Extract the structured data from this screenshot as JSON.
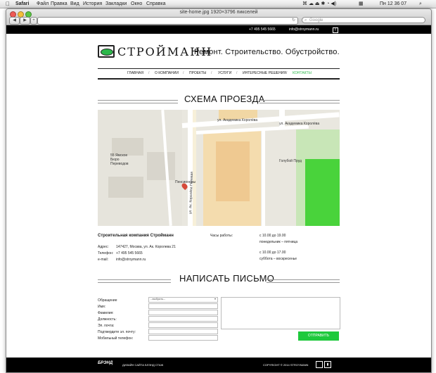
{
  "menubar": {
    "app": "Safari",
    "items": [
      "Файл",
      "Правка",
      "Вид",
      "История",
      "Закладки",
      "Окно",
      "Справка"
    ],
    "clock": "Пн 12 36 07"
  },
  "browser": {
    "window_title": "site-home.jpg 1920×3796 пикселей",
    "back": "◀",
    "forward": "▶",
    "add_tab": "+",
    "search_placeholder": "Google"
  },
  "site": {
    "phone_top": "+7 495 545 5665",
    "email_top": "info@stroymann.ru",
    "social_icon": "f",
    "logo_text": "СТРОЙМАНН",
    "slogan": "Ремонт. Строительство. Обустройство.",
    "nav": [
      "ГЛАВНАЯ",
      "О КОМПАНИИ",
      "ПРОЕКТЫ",
      "УСЛУГИ",
      "ИНТЕРЕСНЫЕ РЕШЕНИЯ",
      "КОНТАКТЫ"
    ],
    "nav_active_color": "#2db84b",
    "map_title": "СХЕМА ПРОЕЗДА",
    "map_labels": [
      "ул. Академика Королёва",
      "ул. Академика Королёва",
      "55 Ямское Бюро Переводов",
      "Пенсионеры",
      "ул. Ак. Королёва Полевая",
      "Голубой Пруд"
    ],
    "company_name": "Строительная компания Стройманн",
    "contacts": [
      {
        "label": "Адрес:",
        "value": "147427, Москва, ул. Ак. Королева 21"
      },
      {
        "label": "Телефон:",
        "value": "+7 495 545 5665"
      },
      {
        "label": "e-mail:",
        "value": "info@stroymann.ru"
      }
    ],
    "hours_label": "Часы работы:",
    "hours": [
      {
        "time": "с 10.00 до 19.00",
        "days": "понедельник – пятница"
      },
      {
        "time": "с 10.00 до 17.00",
        "days": "суббота – воскресенье"
      }
    ],
    "form_title": "НАПИСАТЬ ПИСЬМО",
    "form_fields": [
      "Обращение",
      "Имя:",
      "Фамилия:",
      "Должность:",
      "Эл. почта:",
      "Подтвердите эл. почту:",
      "Мобильный телефон:"
    ],
    "select_placeholder": "--выбрать--",
    "submit_label": "ОТПРАВИТЬ",
    "accent_color": "#1ec93c",
    "footer_logo": "БРЭНД",
    "footer_design": "ДИЗАЙН САЙТА БЛЭНД СТАЖ",
    "copyright": "COPYRIGHT © 2014 STROYMANN"
  }
}
